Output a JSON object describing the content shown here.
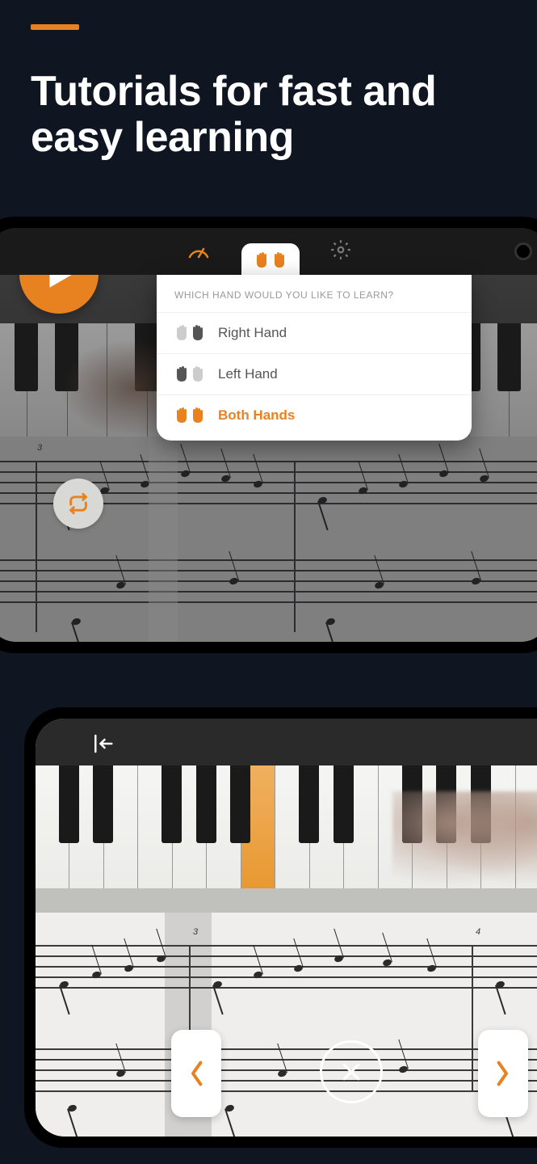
{
  "accent_color": "#e8811f",
  "headline": "Tutorials for fast and easy learning",
  "popover": {
    "title": "WHICH HAND WOULD YOU LIKE TO LEARN?",
    "options": {
      "right": "Right Hand",
      "left": "Left Hand",
      "both": "Both Hands"
    }
  },
  "fingerings": {
    "top_bar3": "3",
    "bottom_bar3": "3",
    "bottom_bar4": "4"
  }
}
